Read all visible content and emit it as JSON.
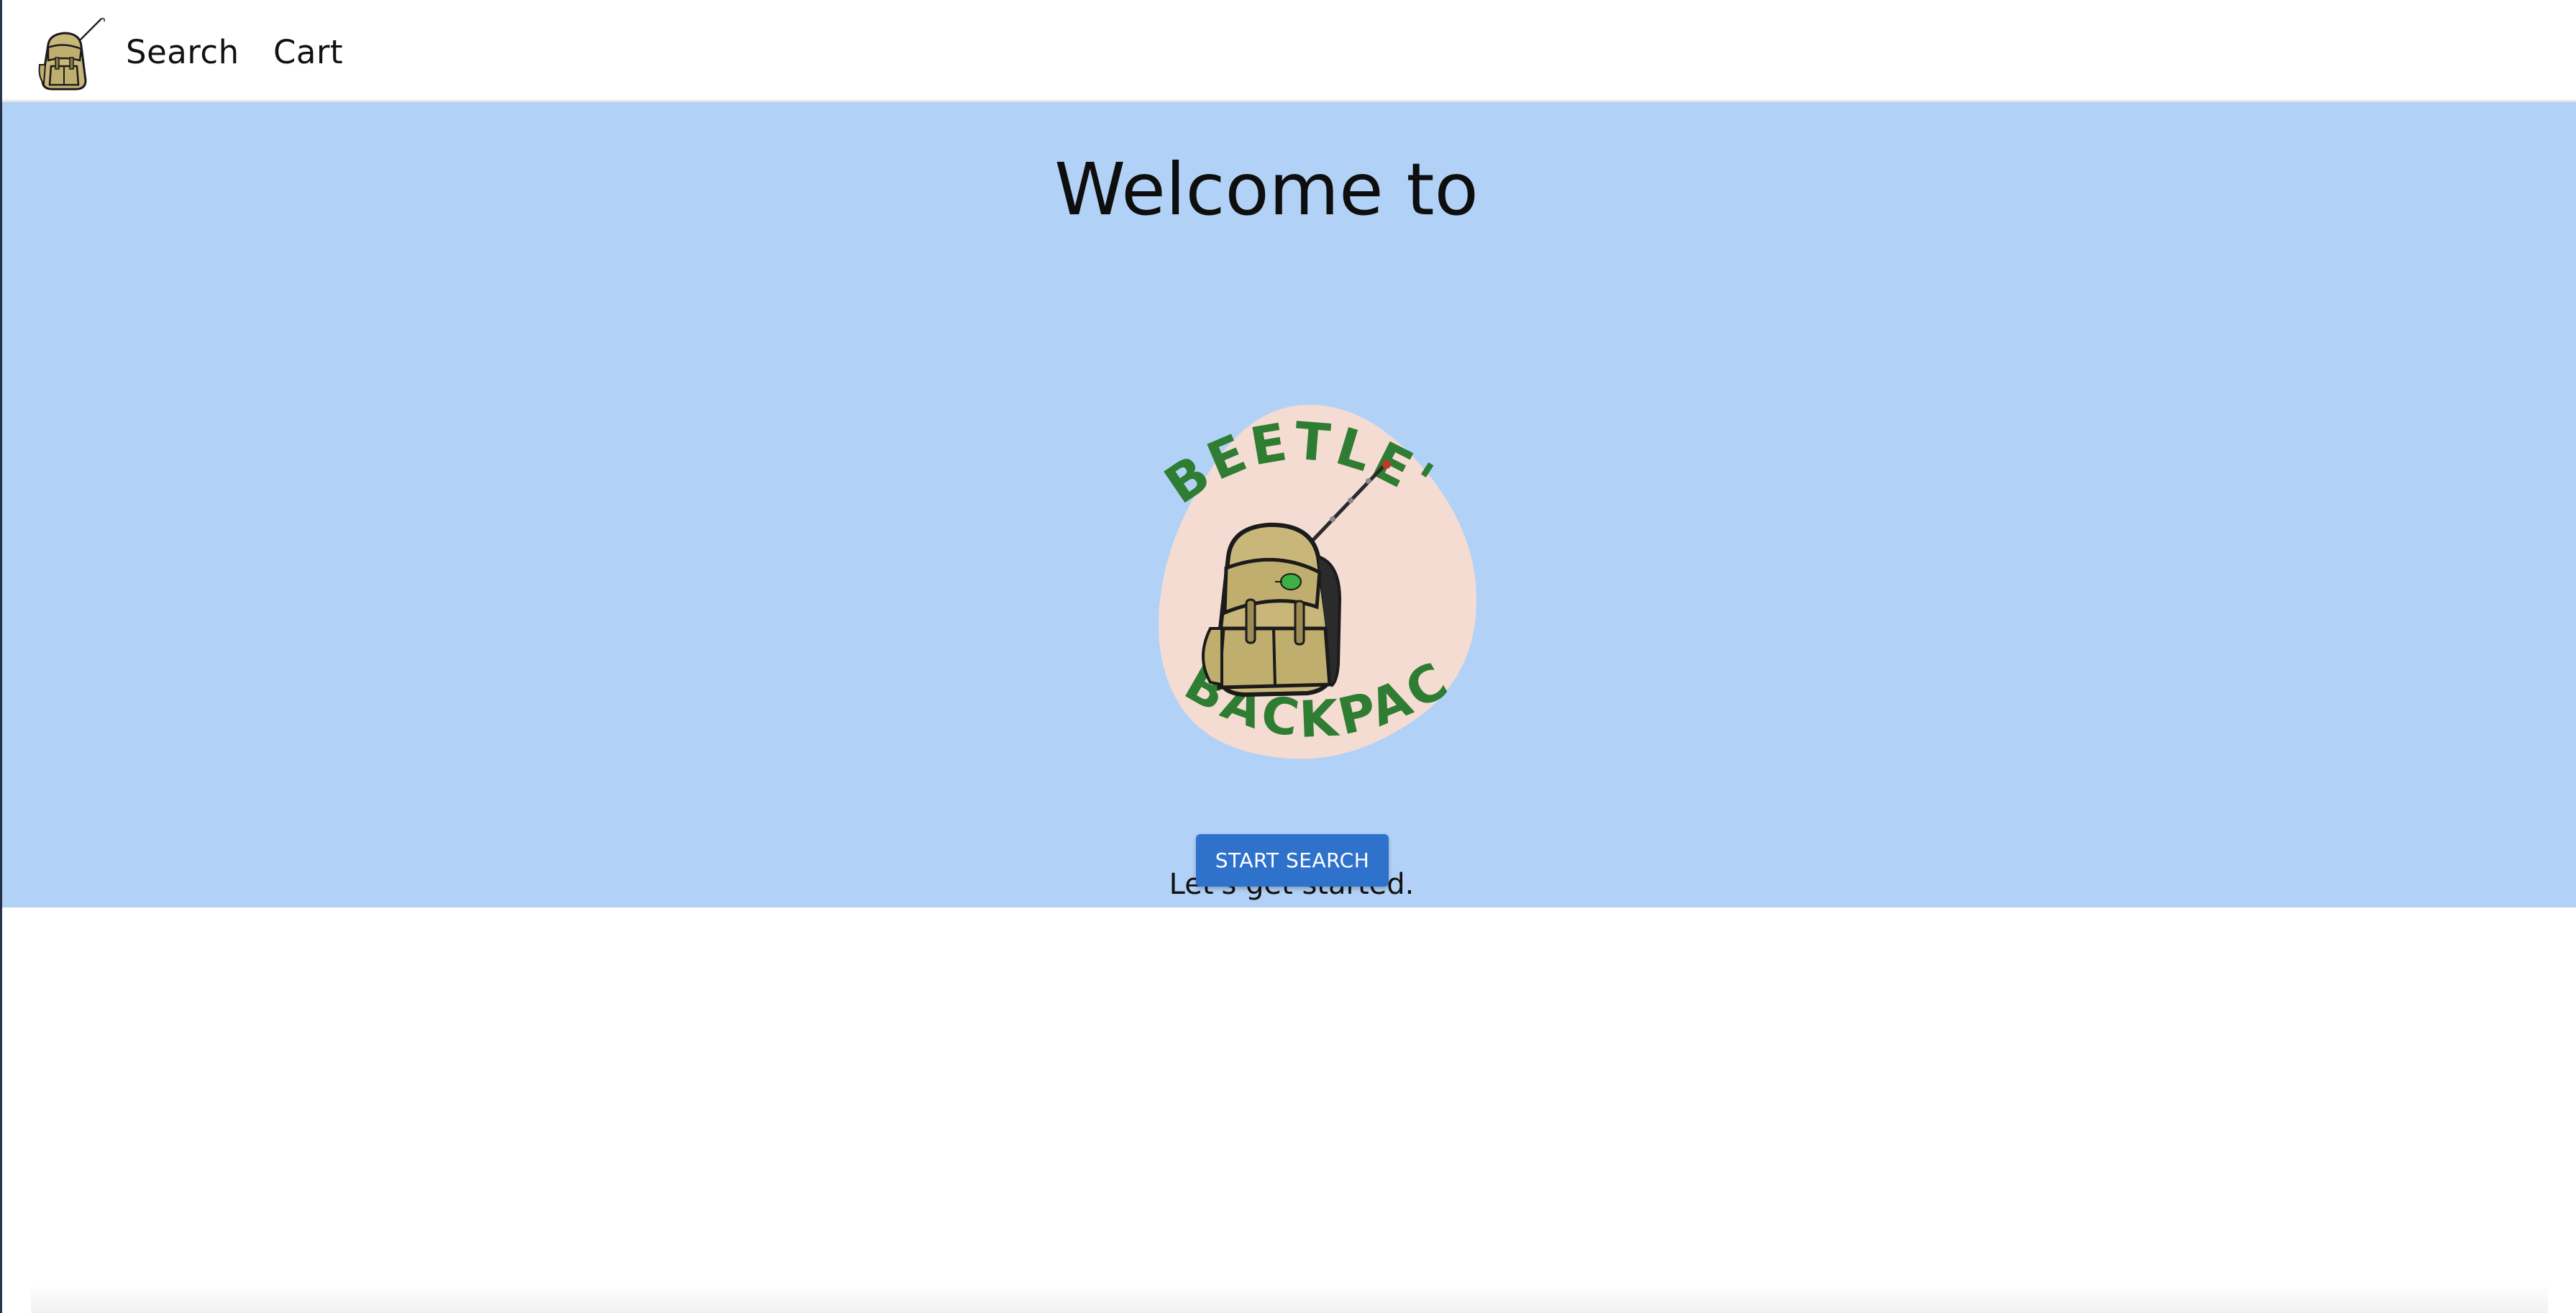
{
  "nav": {
    "logo_icon": "backpack-logo-icon",
    "search_label": "Search",
    "cart_label": "Cart"
  },
  "hero": {
    "title": "Welcome to",
    "logo": {
      "icon": "beetles-backpack-logo",
      "text_top": "BEETLE'S",
      "text_bottom": "BACKPACK"
    },
    "subtitle": "Let's get started.",
    "button_label": "START SEARCH"
  },
  "colors": {
    "hero_background": "#b1d2f6",
    "button": "#2f72cc",
    "logo_text": "#2e7d32",
    "logo_blob": "#f5dcd3",
    "backpack": "#c9b77a"
  }
}
